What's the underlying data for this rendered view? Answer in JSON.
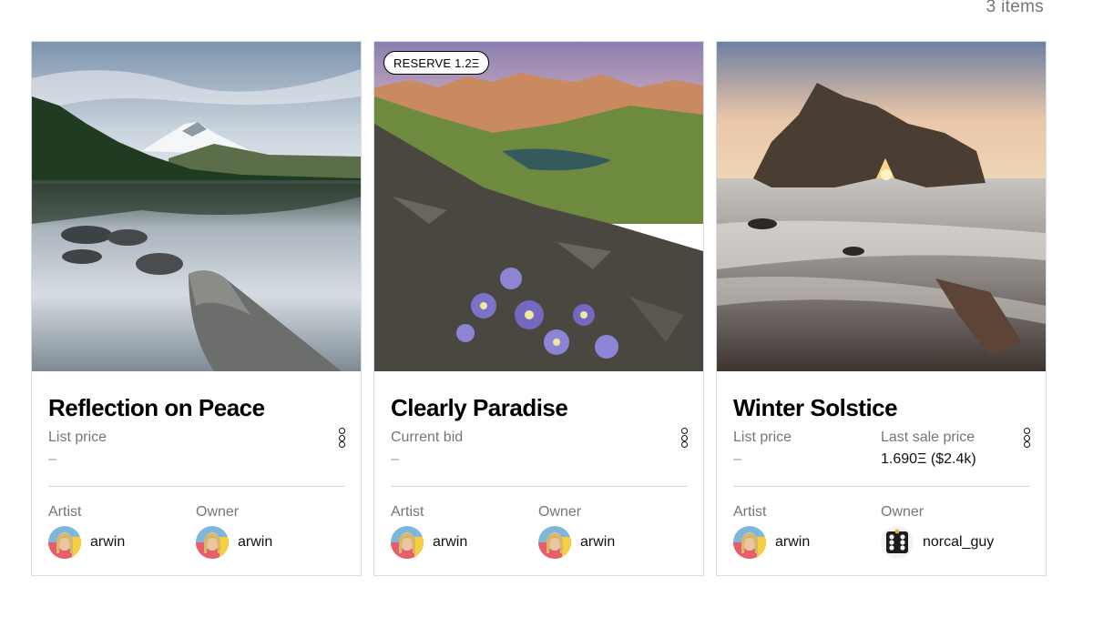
{
  "header": {
    "count_label": "3 items"
  },
  "cards": [
    {
      "title": "Reflection on Peace",
      "badge": "",
      "price_label": "List price",
      "price_value": "–",
      "artist_label": "Artist",
      "artist_name": "arwin",
      "owner_label": "Owner",
      "owner_name": "arwin"
    },
    {
      "title": "Clearly Paradise",
      "badge": "RESERVE 1.2Ξ",
      "price_label": "Current bid",
      "price_value": "–",
      "artist_label": "Artist",
      "artist_name": "arwin",
      "owner_label": "Owner",
      "owner_name": "arwin"
    },
    {
      "title": "Winter Solstice",
      "badge": "",
      "price_label": "List price",
      "price_value": "–",
      "last_sale_label": "Last sale price",
      "last_sale_value": "1.690Ξ ($2.4k)",
      "artist_label": "Artist",
      "artist_name": "arwin",
      "owner_label": "Owner",
      "owner_name": "norcal_guy"
    }
  ],
  "icons": {
    "more": "more-vertical-icon"
  }
}
